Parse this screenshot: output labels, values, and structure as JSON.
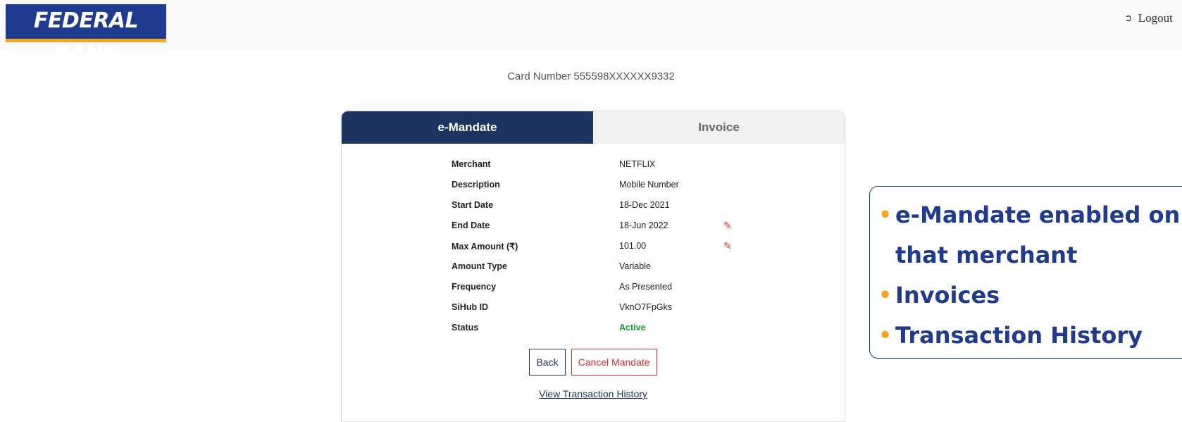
{
  "header": {
    "logo_text": "FEDERAL BANK",
    "logout_label": "Logout",
    "logout_icon": "sign-out-icon"
  },
  "card_number_text": "Card Number 555598XXXXXX9332",
  "tabs": [
    {
      "label": "e-Mandate",
      "active": true
    },
    {
      "label": "Invoice",
      "active": false
    }
  ],
  "mandate": {
    "rows": [
      {
        "label": "Merchant",
        "value": "NETFLIX"
      },
      {
        "label": "Description",
        "value": "Mobile Number"
      },
      {
        "label": "Start Date",
        "value": "18-Dec 2021"
      },
      {
        "label": "End Date",
        "value": "18-Jun 2022"
      },
      {
        "label": "Max Amount (₹)",
        "value": "101.00"
      },
      {
        "label": "Amount Type",
        "value": "Variable"
      },
      {
        "label": "Frequency",
        "value": "As Presented"
      },
      {
        "label": "SiHub ID",
        "value": "VknO7FpGks"
      },
      {
        "label": "Status",
        "value": "Active"
      }
    ]
  },
  "buttons": {
    "back": "Back",
    "cancel": "Cancel Mandate"
  },
  "view_history_link": "View Transaction History",
  "callout": {
    "items": [
      "e-Mandate enabled on that merchant",
      "Invoices",
      "Transaction History"
    ]
  },
  "colors": {
    "brand_blue": "#1d3461",
    "accent_orange": "#f5a623",
    "danger_red": "#e02b2b",
    "status_green": "#1a9a32"
  }
}
